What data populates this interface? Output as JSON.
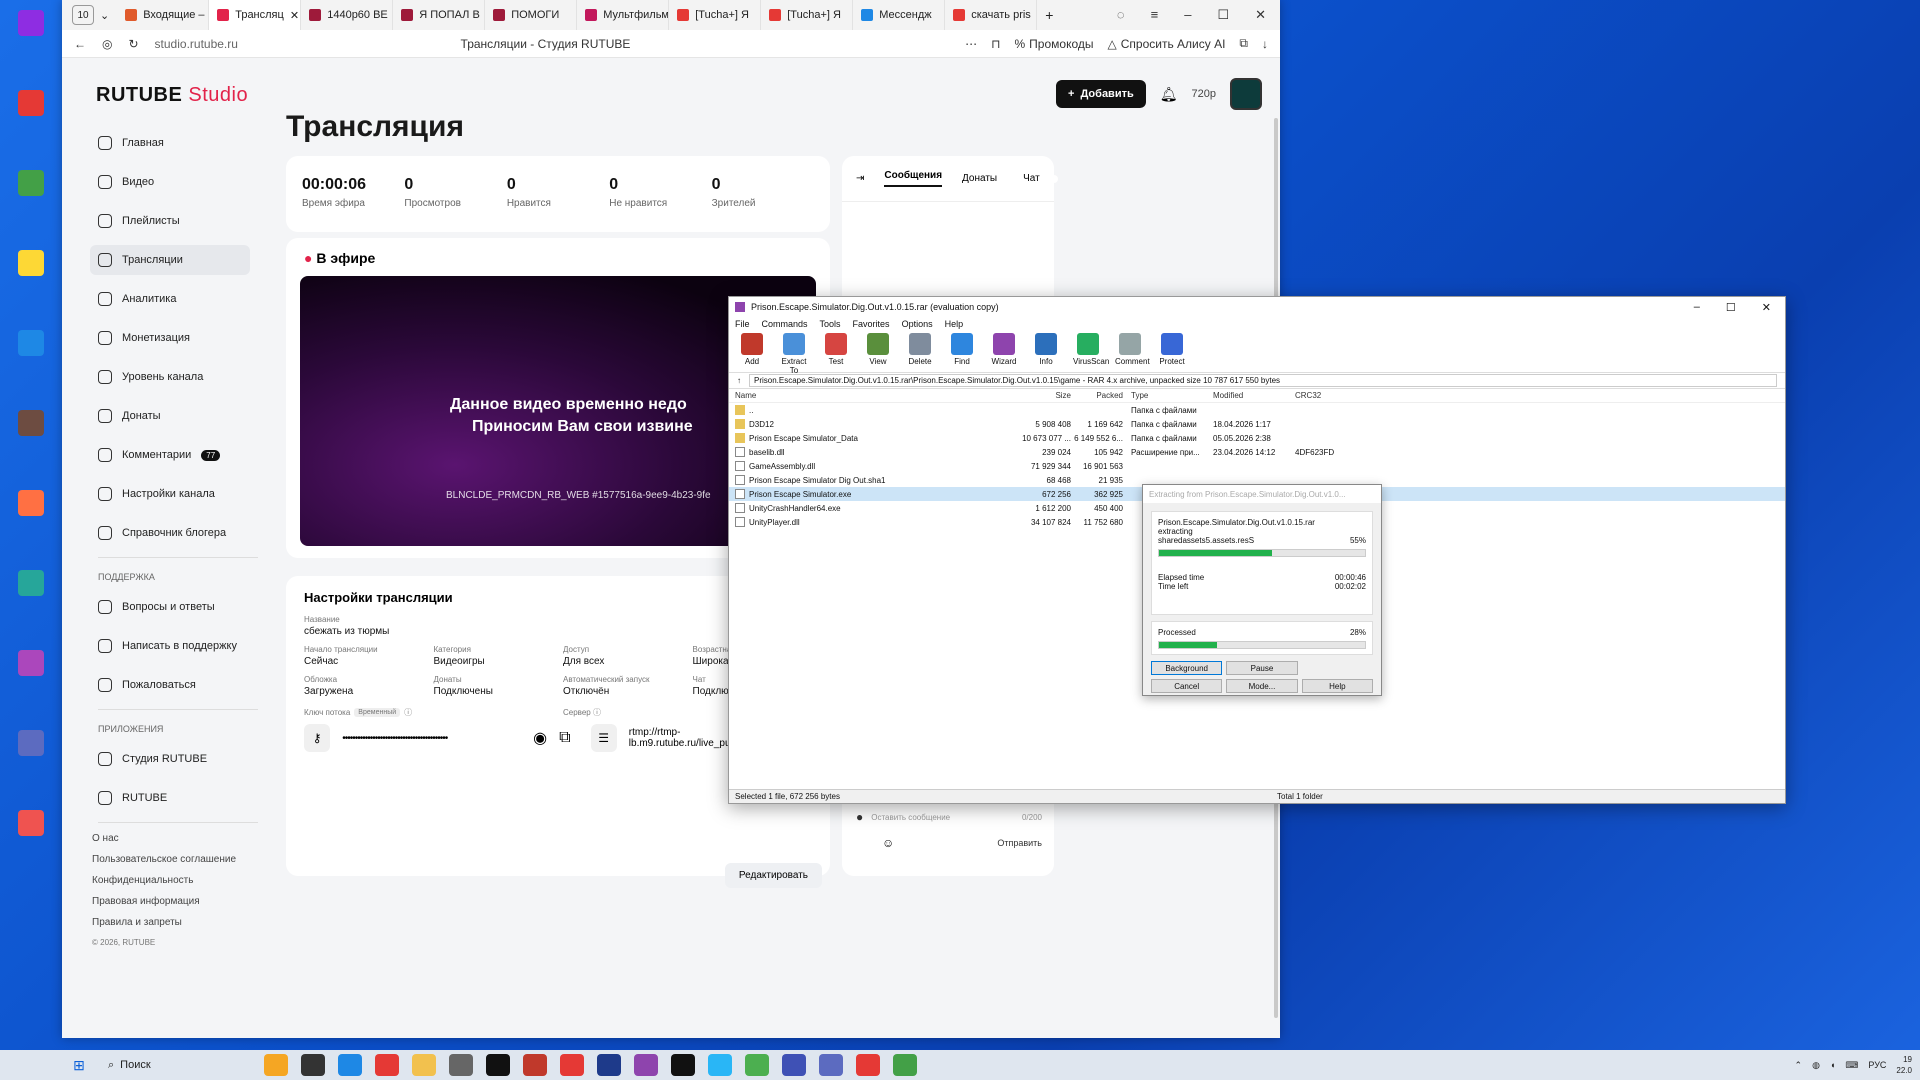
{
  "browser": {
    "tab_count": "10",
    "tabs": [
      {
        "label": "Входящие –",
        "color": "#e05a2b",
        "active": false
      },
      {
        "label": "Трансляц",
        "color": "#e2234a",
        "active": true
      },
      {
        "label": "1440p60 BE",
        "color": "#9e1a3a",
        "active": false
      },
      {
        "label": "Я ПОПАЛ В",
        "color": "#9e1a3a",
        "active": false
      },
      {
        "label": "ПОМОГИ",
        "color": "#9e1a3a",
        "active": false
      },
      {
        "label": "Мультфильм",
        "color": "#c2185b",
        "active": false
      },
      {
        "label": "[Tucha+] Я",
        "color": "#e53935",
        "active": false
      },
      {
        "label": "[Tucha+] Я",
        "color": "#e53935",
        "active": false
      },
      {
        "label": "Мессендж",
        "color": "#1e88e5",
        "active": false
      },
      {
        "label": "скачать pris",
        "color": "#e53935",
        "active": false
      }
    ],
    "url": "studio.rutube.ru",
    "page_title": "Трансляции - Студия RUTUBE",
    "promo": "Промокоды",
    "alice": "Спросить Алису AI"
  },
  "site": {
    "logo_main": "RUTUBE",
    "logo_sub": "Studio",
    "add_button": "Добавить",
    "quality": "720p"
  },
  "nav": [
    {
      "label": "Главная",
      "name": "home"
    },
    {
      "label": "Видео",
      "name": "video"
    },
    {
      "label": "Плейлисты",
      "name": "playlists"
    },
    {
      "label": "Трансляции",
      "name": "streams",
      "active": true
    },
    {
      "label": "Аналитика",
      "name": "analytics"
    },
    {
      "label": "Монетизация",
      "name": "monetization"
    },
    {
      "label": "Уровень канала",
      "name": "channel-level"
    },
    {
      "label": "Донаты",
      "name": "donates"
    },
    {
      "label": "Комментарии",
      "name": "comments",
      "badge": "77"
    },
    {
      "label": "Настройки канала",
      "name": "channel-settings"
    },
    {
      "label": "Справочник блогера",
      "name": "blogger-guide"
    }
  ],
  "support": {
    "heading": "ПОДДЕРЖКА",
    "items": [
      "Вопросы и ответы",
      "Написать в поддержку",
      "Пожаловаться"
    ]
  },
  "apps": {
    "heading": "ПРИЛОЖЕНИЯ",
    "items": [
      "Студия RUTUBE",
      "RUTUBE"
    ]
  },
  "footer_links": [
    "О нас",
    "Пользовательское соглашение",
    "Конфиденциальность",
    "Правовая информация",
    "Правила и запреты"
  ],
  "copyright": "© 2026, RUTUBE",
  "main": {
    "title": "Трансляция",
    "stats": [
      {
        "value": "00:00:06",
        "label": "Время эфира"
      },
      {
        "value": "0",
        "label": "Просмотров"
      },
      {
        "value": "0",
        "label": "Нравится"
      },
      {
        "value": "0",
        "label": "Не нравится"
      },
      {
        "value": "0",
        "label": "Зрителей"
      }
    ],
    "live_label": "В эфире",
    "player_msg1": "Данное видео временно недо",
    "player_msg2": "Приносим Вам свои извине",
    "player_code": "BLNCLDE_PRMCDN_RB_WEB #1577516a-9ee9-4b23-9fe"
  },
  "settings": {
    "title": "Настройки трансляции",
    "name_label": "Название",
    "name_value": "сбежать из тюрмы",
    "fields": [
      {
        "label": "Начало трансляции",
        "value": "Сейчас"
      },
      {
        "label": "Категория",
        "value": "Видеоигры"
      },
      {
        "label": "Доступ",
        "value": "Для всех"
      },
      {
        "label": "Возрастная категория",
        "value": "Широкая аудитория"
      },
      {
        "label": "Обложка",
        "value": "Загружена"
      },
      {
        "label": "Донаты",
        "value": "Подключены"
      },
      {
        "label": "Автоматический запуск",
        "value": "Отключён"
      },
      {
        "label": "Чат",
        "value": "Подключён"
      }
    ],
    "key_label": "Ключ потока",
    "key_tag": "Временный",
    "server_label": "Сервер",
    "key_dots": "••••••••••••••••••••••••••••••••••••••••••",
    "server_value": "rtmp://rtmp-lb.m9.rutube.ru/live_push",
    "edit_button": "Редактировать"
  },
  "chat": {
    "tab_messages": "Сообщения",
    "tab_donates": "Донаты",
    "chat_label": "Чат",
    "input_placeholder": "Оставить сообщение",
    "counter": "0/200",
    "send": "Отправить"
  },
  "winrar": {
    "title": "Prison.Escape.Simulator.Dig.Out.v1.0.15.rar (evaluation copy)",
    "menu": [
      "File",
      "Commands",
      "Tools",
      "Favorites",
      "Options",
      "Help"
    ],
    "tools": [
      {
        "label": "Add",
        "color": "#c0392b"
      },
      {
        "label": "Extract To",
        "color": "#4a90d9"
      },
      {
        "label": "Test",
        "color": "#d64541"
      },
      {
        "label": "View",
        "color": "#5a8f3c"
      },
      {
        "label": "Delete",
        "color": "#7f8c9d"
      },
      {
        "label": "Find",
        "color": "#2e86de"
      },
      {
        "label": "Wizard",
        "color": "#8e44ad"
      },
      {
        "label": "Info",
        "color": "#2c6fbb"
      },
      {
        "label": "VirusScan",
        "color": "#27ae60"
      },
      {
        "label": "Comment",
        "color": "#95a5a6"
      },
      {
        "label": "Protect",
        "color": "#3867d6"
      }
    ],
    "path": "Prison.Escape.Simulator.Dig.Out.v1.0.15.rar\\Prison.Escape.Simulator.Dig.Out.v1.0.15\\game - RAR 4.x archive, unpacked size 10 787 617 550 bytes",
    "columns": [
      "Name",
      "Size",
      "Packed",
      "Type",
      "Modified",
      "CRC32"
    ],
    "rows": [
      {
        "name": "..",
        "size": "",
        "packed": "",
        "type": "Папка с файлами",
        "modified": "",
        "crc": "",
        "kind": "folder"
      },
      {
        "name": "D3D12",
        "size": "5 908 408",
        "packed": "1 169 642",
        "type": "Папка с файлами",
        "modified": "18.04.2026 1:17",
        "crc": "",
        "kind": "folder"
      },
      {
        "name": "Prison Escape Simulator_Data",
        "size": "10 673 077 ...",
        "packed": "6 149 552 6...",
        "type": "Папка с файлами",
        "modified": "05.05.2026 2:38",
        "crc": "",
        "kind": "folder"
      },
      {
        "name": "baselib.dll",
        "size": "239 024",
        "packed": "105 942",
        "type": "Расширение при...",
        "modified": "23.04.2026 14:12",
        "crc": "4DF623FD",
        "kind": "file"
      },
      {
        "name": "GameAssembly.dll",
        "size": "71 929 344",
        "packed": "16 901 563",
        "type": "",
        "modified": "",
        "crc": "",
        "kind": "file"
      },
      {
        "name": "Prison Escape Simulator Dig Out.sha1",
        "size": "68 468",
        "packed": "21 935",
        "type": "",
        "modified": "",
        "crc": "",
        "kind": "file"
      },
      {
        "name": "Prison Escape Simulator.exe",
        "size": "672 256",
        "packed": "362 925",
        "type": "",
        "modified": "",
        "crc": "",
        "kind": "file",
        "selected": true
      },
      {
        "name": "UnityCrashHandler64.exe",
        "size": "1 612 200",
        "packed": "450 400",
        "type": "",
        "modified": "",
        "crc": "",
        "kind": "file"
      },
      {
        "name": "UnityPlayer.dll",
        "size": "34 107 824",
        "packed": "11 752 680",
        "type": "",
        "modified": "",
        "crc": "",
        "kind": "file"
      }
    ],
    "status_left": "Selected 1 file, 672 256 bytes",
    "status_right": "Total 1 folder"
  },
  "extract": {
    "title": "Extracting from Prison.Escape.Simulator.Dig.Out.v1.0...",
    "archive": "Prison.Escape.Simulator.Dig.Out.v1.0.15.rar",
    "action": "extracting",
    "file": "sharedassets5.assets.resS",
    "file_pct": "55%",
    "file_progress": 0.55,
    "elapsed_label": "Elapsed time",
    "elapsed": "00:00:46",
    "left_label": "Time left",
    "left": "00:02:02",
    "processed_label": "Processed",
    "processed_pct": "28%",
    "processed_progress": 0.28,
    "buttons": [
      "Background",
      "Pause",
      "Cancel",
      "Mode...",
      "Help"
    ]
  },
  "taskbar": {
    "search": "Поиск",
    "lang": "РУС",
    "time": "19",
    "date": "22.0"
  }
}
